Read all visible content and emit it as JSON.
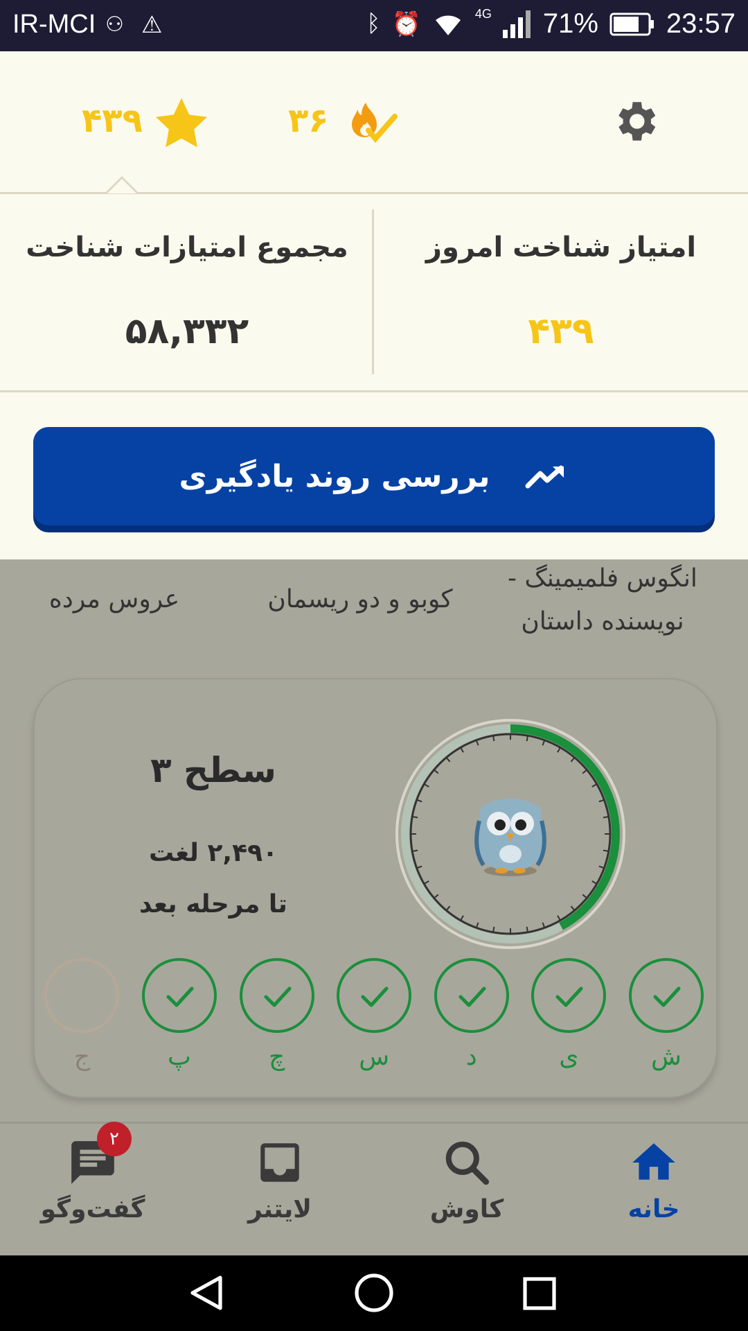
{
  "status_bar": {
    "carrier": "IR-MCI",
    "network": "4G",
    "battery": "71%",
    "time": "23:57"
  },
  "header": {
    "stars_value": "۴۳۹",
    "streak_value": "۳۶",
    "star_icon": "star-icon",
    "streak_icon": "flame-check-icon",
    "settings_icon": "gear-icon"
  },
  "stats": {
    "today_label": "امتیاز شناخت امروز",
    "today_value": "۴۳۹",
    "total_label": "مجموع امتیازات شناخت",
    "total_value": "۵۸,۳۳۲"
  },
  "trend_button": {
    "label": "بررسی روند یادگیری",
    "icon": "trending-up-icon"
  },
  "books": [
    "انگوس فلمیمینگ - نویسنده داستان",
    "کوبو و دو ریسمان",
    "عروس مرده"
  ],
  "level_card": {
    "title": "سطح ۳",
    "words": "۲,۴۹۰ لغت",
    "next": "تا مرحله بعد",
    "progress": 0.42,
    "steps": [
      {
        "label": "ش",
        "done": true
      },
      {
        "label": "ی",
        "done": true
      },
      {
        "label": "د",
        "done": true
      },
      {
        "label": "س",
        "done": true
      },
      {
        "label": "چ",
        "done": true
      },
      {
        "label": "پ",
        "done": true
      },
      {
        "label": "ج",
        "done": false
      }
    ]
  },
  "nav": {
    "home": "خانه",
    "explore": "کاوش",
    "leitner": "لایتنر",
    "chat": "گفت‌وگو",
    "chat_badge": "۲"
  },
  "colors": {
    "accent": "#0642a4",
    "yellow": "#f6c518",
    "green": "#1a8f3c"
  }
}
